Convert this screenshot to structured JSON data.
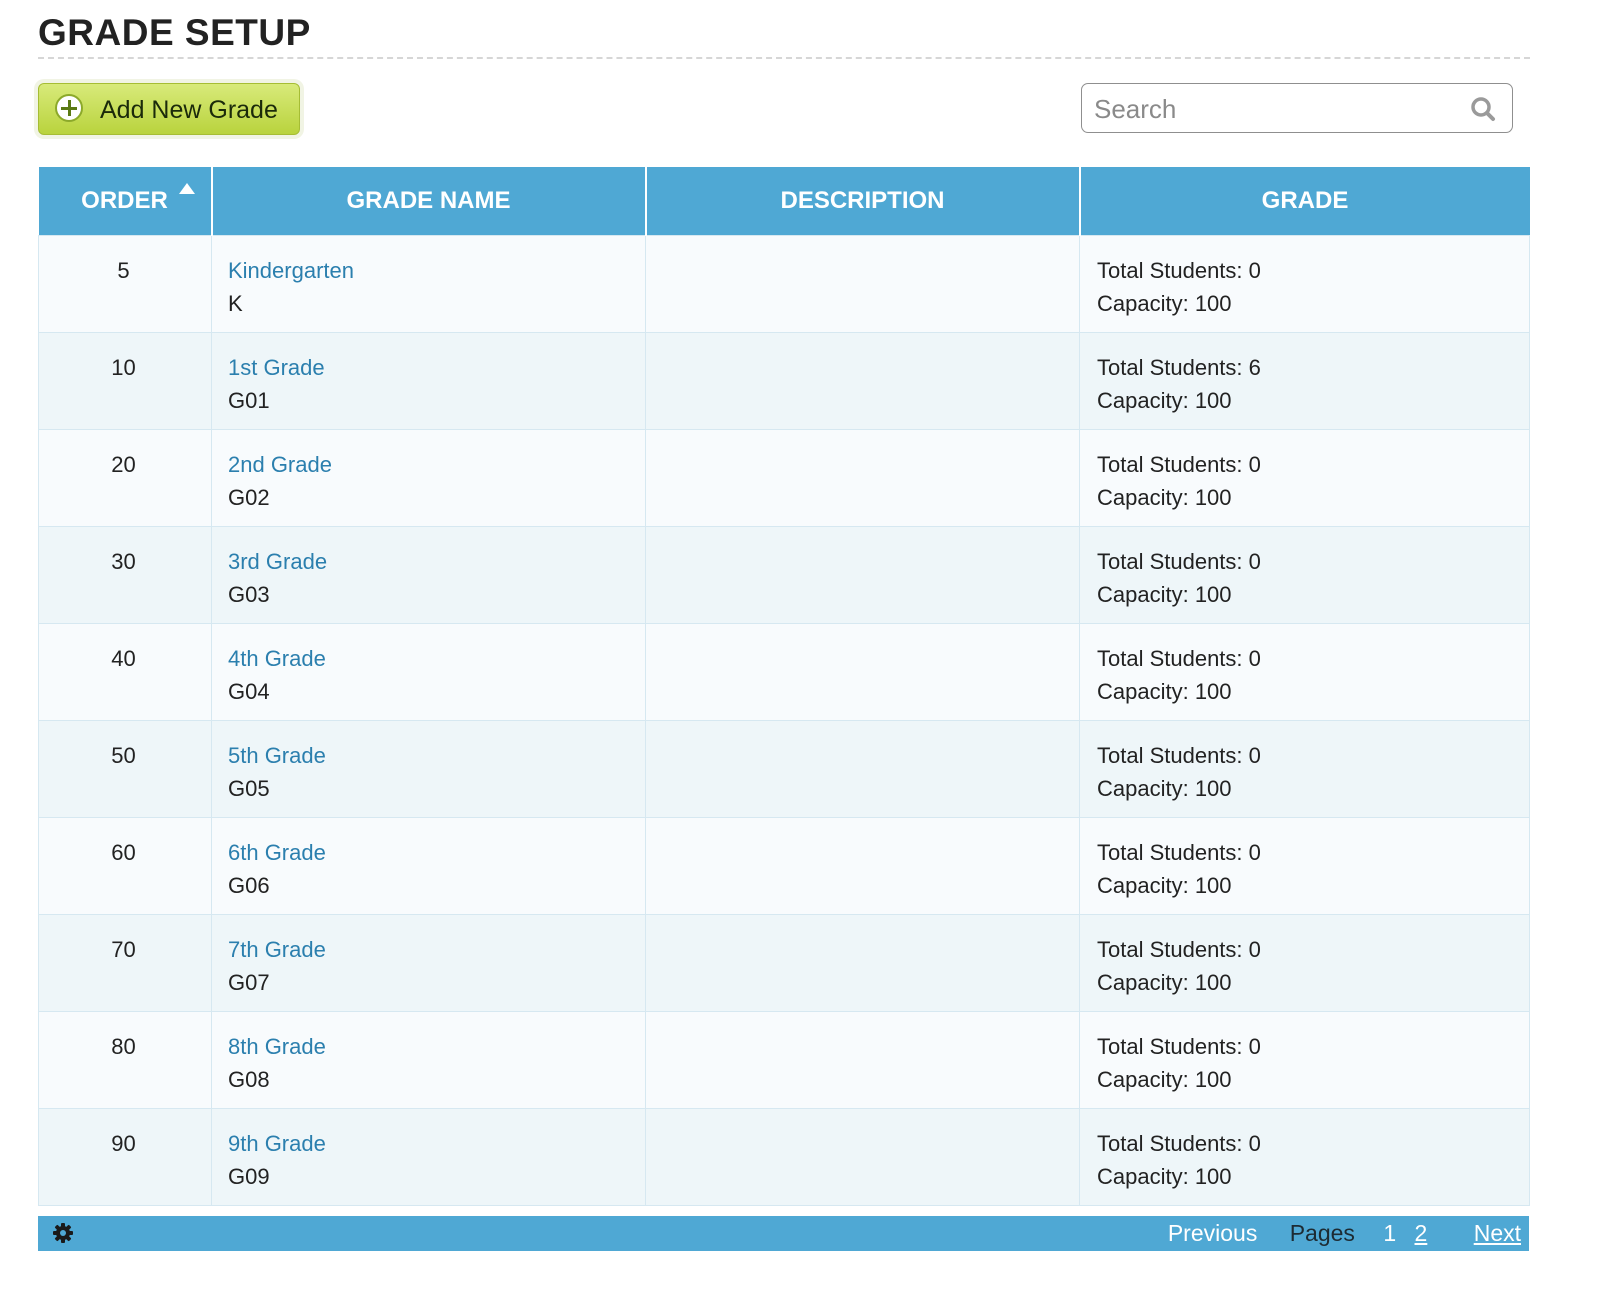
{
  "page": {
    "title": "GRADE SETUP"
  },
  "toolbar": {
    "add_label": "Add New Grade",
    "search_placeholder": "Search"
  },
  "table": {
    "headers": {
      "order": "ORDER",
      "grade_name": "GRADE NAME",
      "description": "DESCRIPTION",
      "grade": "GRADE"
    },
    "sort_column": "order",
    "sort_direction": "ascending",
    "rows": [
      {
        "order": "5",
        "name": "Kindergarten",
        "code": "K",
        "description": "",
        "total": "Total Students: 0",
        "capacity": "Capacity: 100"
      },
      {
        "order": "10",
        "name": "1st Grade",
        "code": "G01",
        "description": "",
        "total": "Total Students: 6",
        "capacity": "Capacity: 100"
      },
      {
        "order": "20",
        "name": "2nd Grade",
        "code": "G02",
        "description": "",
        "total": "Total Students: 0",
        "capacity": "Capacity: 100"
      },
      {
        "order": "30",
        "name": "3rd Grade",
        "code": "G03",
        "description": "",
        "total": "Total Students: 0",
        "capacity": "Capacity: 100"
      },
      {
        "order": "40",
        "name": "4th Grade",
        "code": "G04",
        "description": "",
        "total": "Total Students: 0",
        "capacity": "Capacity: 100"
      },
      {
        "order": "50",
        "name": "5th Grade",
        "code": "G05",
        "description": "",
        "total": "Total Students: 0",
        "capacity": "Capacity: 100"
      },
      {
        "order": "60",
        "name": "6th Grade",
        "code": "G06",
        "description": "",
        "total": "Total Students: 0",
        "capacity": "Capacity: 100"
      },
      {
        "order": "70",
        "name": "7th Grade",
        "code": "G07",
        "description": "",
        "total": "Total Students: 0",
        "capacity": "Capacity: 100"
      },
      {
        "order": "80",
        "name": "8th Grade",
        "code": "G08",
        "description": "",
        "total": "Total Students: 0",
        "capacity": "Capacity: 100"
      },
      {
        "order": "90",
        "name": "9th Grade",
        "code": "G09",
        "description": "",
        "total": "Total Students: 0",
        "capacity": "Capacity: 100"
      }
    ]
  },
  "pagination": {
    "previous": "Previous",
    "pages_label": "Pages",
    "current_page": "1",
    "other_page": "2",
    "next": "Next"
  },
  "icons": {
    "add": "plus-circle-icon",
    "search": "search-icon",
    "sort": "sort-ascending-icon",
    "settings": "gear-icon"
  },
  "colors": {
    "header_blue": "#4fa8d4",
    "link_blue": "#2b7fae",
    "button_green": "#c3dc52"
  }
}
